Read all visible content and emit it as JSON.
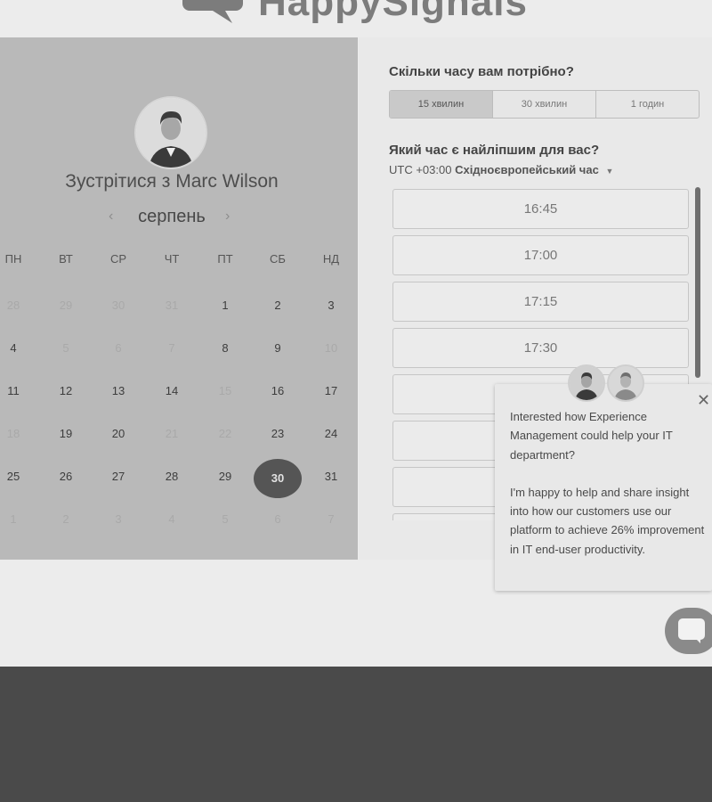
{
  "header": {
    "logo_text": "HappySignals"
  },
  "booking": {
    "title": "Зустрітися з Marc Wilson",
    "month": "серпень",
    "prev_icon": "chevron-left",
    "next_icon": "chevron-right"
  },
  "calendar": {
    "weekdays": [
      "ПН",
      "ВТ",
      "СР",
      "ЧТ",
      "ПТ",
      "СБ",
      "НД"
    ],
    "weeks": [
      [
        "28",
        "29",
        "30",
        "31",
        "1",
        "2",
        "3"
      ],
      [
        "4",
        "5",
        "6",
        "7",
        "8",
        "9",
        "10"
      ],
      [
        "11",
        "12",
        "13",
        "14",
        "15",
        "16",
        "17"
      ],
      [
        "18",
        "19",
        "20",
        "21",
        "22",
        "23",
        "24"
      ],
      [
        "25",
        "26",
        "27",
        "28",
        "29",
        "30",
        "31"
      ],
      [
        "1",
        "2",
        "3",
        "4",
        "5",
        "6",
        "7"
      ]
    ],
    "selected_day": "30"
  },
  "duration": {
    "question": "Скільки часу вам потрібно?",
    "options": [
      "15 хвилин",
      "30 хвилин",
      "1 годин"
    ],
    "selected": "15 хвилин"
  },
  "time": {
    "question": "Який час є найліпшим для вас?",
    "tz_offset": "UTC +03:00",
    "tz_name": "Східноєвропейський час",
    "slots": [
      "16:45",
      "17:00",
      "17:15",
      "17:30",
      "",
      "",
      "",
      ""
    ]
  },
  "chat_popup": {
    "paragraph1": "Interested how Experience Management could help your IT department?",
    "paragraph2": "I'm happy to help and share insight into how our customers use our platform to achieve 26% improvement in IT end-user productivity.",
    "close_icon": "close-icon"
  },
  "chat_button": {
    "icon": "chat-bubble-icon"
  },
  "colors": {
    "left_panel": "#b9b9b9",
    "selected_day": "#555555",
    "page_bottom": "#4a4a4a"
  }
}
